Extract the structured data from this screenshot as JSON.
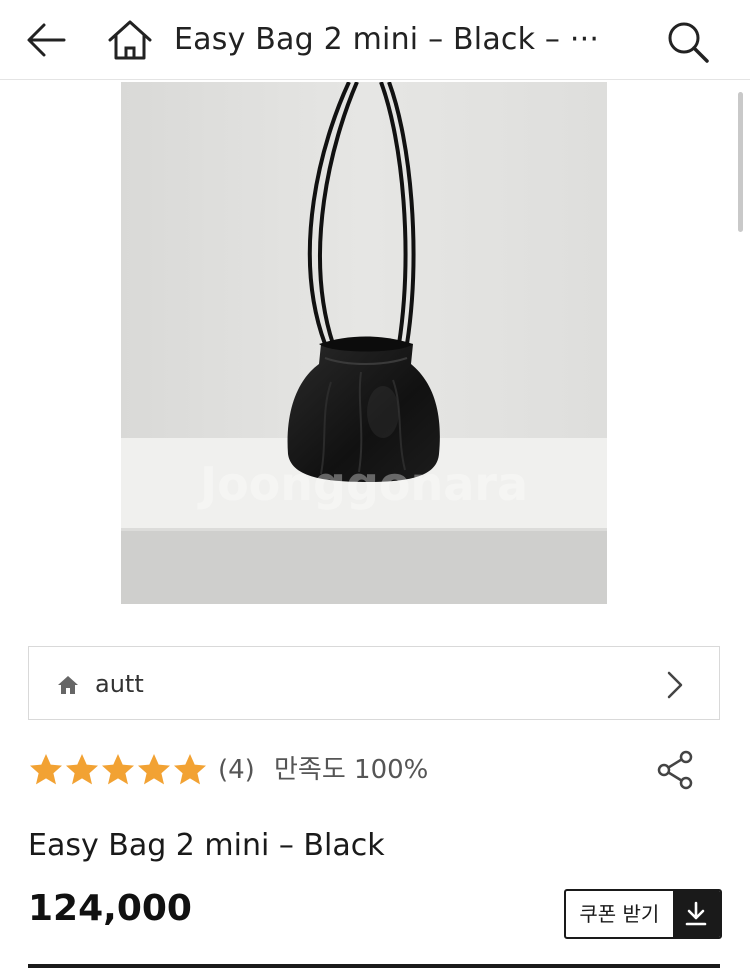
{
  "header": {
    "title": "Easy Bag 2 mini – Black – ···",
    "back_icon": "back-arrow-icon",
    "home_icon": "home-icon",
    "search_icon": "search-icon"
  },
  "product_image": {
    "alt": "Easy Bag 2 mini – Black",
    "watermark": "Joonggonara"
  },
  "store": {
    "icon": "home-icon",
    "name": "autt",
    "chevron_icon": "chevron-right-icon"
  },
  "rating": {
    "stars": 5,
    "max_stars": 5,
    "star_color": "#f2a233",
    "review_count": "(4)",
    "satisfaction": "만족도 100%",
    "share_icon": "share-icon"
  },
  "product": {
    "name": "Easy Bag 2 mini – Black",
    "price": "124,000"
  },
  "coupon": {
    "label": "쿠폰 받기",
    "icon": "download-icon"
  }
}
